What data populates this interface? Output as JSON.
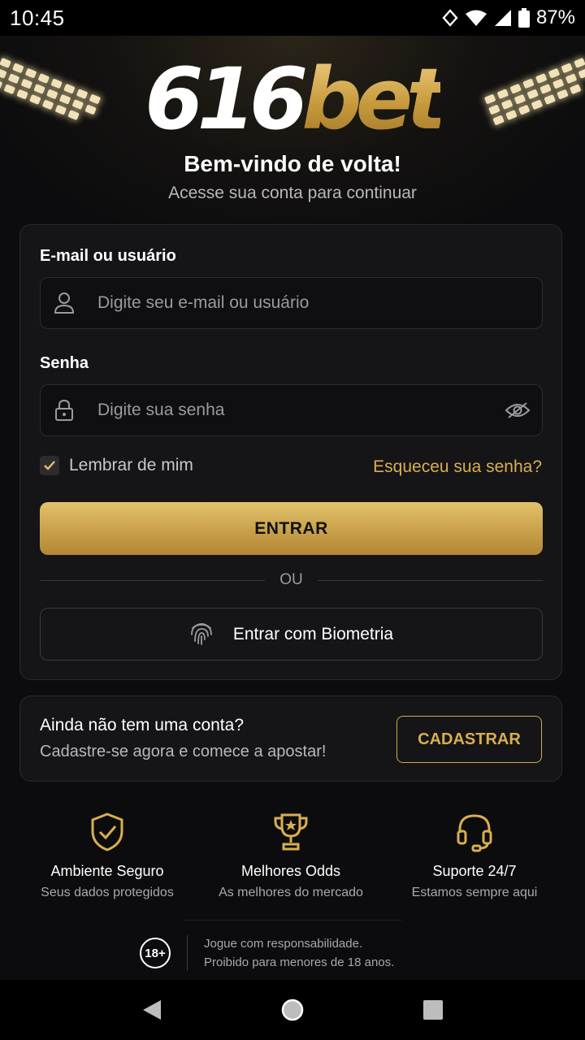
{
  "status_bar": {
    "time": "10:45",
    "battery": "87%"
  },
  "hero": {
    "logo_number": "616",
    "logo_word": "bet",
    "title": "Bem-vindo de volta!",
    "subtitle": "Acesse sua conta para continuar"
  },
  "login": {
    "email_label": "E-mail ou usuário",
    "email_placeholder": "Digite seu e-mail ou usuário",
    "password_label": "Senha",
    "password_placeholder": "Digite sua senha",
    "remember_label": "Lembrar de mim",
    "remember_checked": true,
    "forgot_label": "Esqueceu sua senha?",
    "submit_label": "ENTRAR",
    "divider_label": "OU",
    "biometric_label": "Entrar com Biometria"
  },
  "register": {
    "title": "Ainda não tem uma conta?",
    "subtitle": "Cadastre-se agora e comece a apostar!",
    "button_label": "CADASTRAR"
  },
  "features": [
    {
      "icon": "shield-check-icon",
      "title": "Ambiente Seguro",
      "subtitle": "Seus dados protegidos"
    },
    {
      "icon": "trophy-icon",
      "title": "Melhores Odds",
      "subtitle": "As melhores do mercado"
    },
    {
      "icon": "headset-icon",
      "title": "Suporte 24/7",
      "subtitle": "Estamos sempre aqui"
    }
  ],
  "footer": {
    "age_badge": "18+",
    "line1": "Jogue com responsabilidade.",
    "line2": "Proibido para menores de 18 anos."
  },
  "colors": {
    "accent": "#d9ae4e",
    "background": "#0c0c0e",
    "card": "#151518"
  }
}
